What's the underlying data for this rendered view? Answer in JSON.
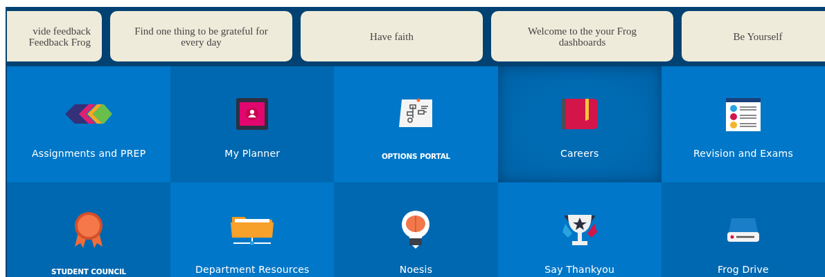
{
  "banner_cards": [
    {
      "text": "vide feedback\nFeedback Frog",
      "clipped": true
    },
    {
      "text": "Find one thing to be grateful for every day",
      "clipped": false
    },
    {
      "text": "Have faith",
      "clipped": false
    },
    {
      "text": "Welcome to the your Frog dashboards",
      "clipped": false
    },
    {
      "text": "Be Yourself",
      "clipped": false
    }
  ],
  "tiles": [
    {
      "label": "Assignments and PREP",
      "caps": false,
      "highlighted": false
    },
    {
      "label": "My Planner",
      "caps": false,
      "highlighted": false
    },
    {
      "label": "OPTIONS PORTAL",
      "caps": true,
      "highlighted": false
    },
    {
      "label": "Careers",
      "caps": false,
      "highlighted": true
    },
    {
      "label": "Revision and Exams",
      "caps": false,
      "highlighted": false
    },
    {
      "label": "STUDENT COUNCIL",
      "caps": true,
      "highlighted": false
    },
    {
      "label": "Department Resources",
      "caps": false,
      "highlighted": false
    },
    {
      "label": "Noesis",
      "caps": false,
      "highlighted": false
    },
    {
      "label": "Say Thankyou",
      "caps": false,
      "highlighted": false
    },
    {
      "label": "Frog Drive",
      "caps": false,
      "highlighted": false
    }
  ]
}
